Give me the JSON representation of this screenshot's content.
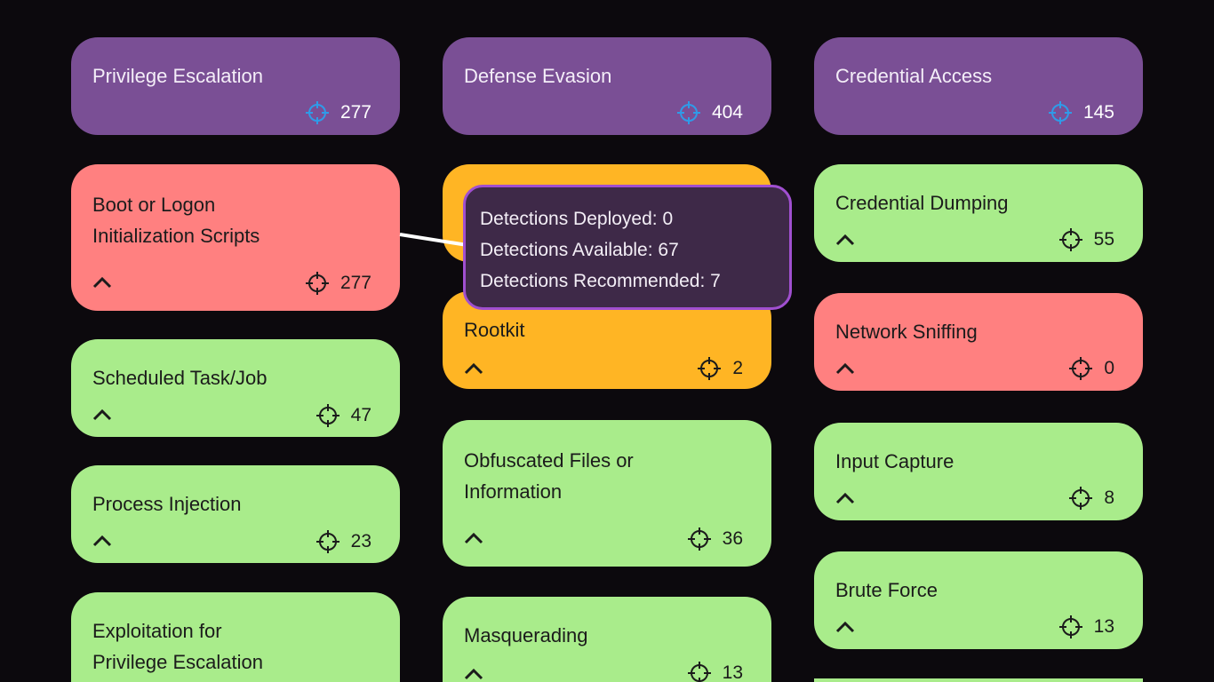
{
  "columns": [
    {
      "header": {
        "title": "Privilege Escalation",
        "count": "277"
      },
      "cards": [
        {
          "title": "Boot or Logon\nInitialization Scripts",
          "count": "277",
          "status": "red"
        },
        {
          "title": "Scheduled Task/Job",
          "count": "47",
          "status": "green"
        },
        {
          "title": "Process Injection",
          "count": "23",
          "status": "green"
        },
        {
          "title": "Exploitation for\nPrivilege Escalation",
          "count": "",
          "status": "green"
        }
      ]
    },
    {
      "header": {
        "title": "Defense Evasion",
        "count": "404"
      },
      "cards": [
        {
          "title": "",
          "count": "",
          "status": "orange"
        },
        {
          "title": "Rootkit",
          "count": "2",
          "status": "orange"
        },
        {
          "title": "Obfuscated Files or\nInformation",
          "count": "36",
          "status": "green"
        },
        {
          "title": "Masquerading",
          "count": "13",
          "status": "green"
        }
      ]
    },
    {
      "header": {
        "title": "Credential Access",
        "count": "145"
      },
      "cards": [
        {
          "title": "Credential Dumping",
          "count": "55",
          "status": "green"
        },
        {
          "title": "Network Sniffing",
          "count": "0",
          "status": "red"
        },
        {
          "title": "Input Capture",
          "count": "8",
          "status": "green"
        },
        {
          "title": "Brute Force",
          "count": "13",
          "status": "green"
        }
      ]
    }
  ],
  "tooltip": {
    "deployed": "Detections Deployed: 0",
    "available": "Detections Available: 67",
    "recommended": "Detections Recommended: 7"
  },
  "colors": {
    "purple": "#7a4f95",
    "red": "#ff8080",
    "green": "#a9ec8b",
    "orange": "#ffb524",
    "tooltip_bg": "#3e2948",
    "tooltip_border": "#a04fd0",
    "crosshair_header": "#2f9be8"
  },
  "icons": {
    "count": "crosshair-icon",
    "expand": "chevron-up-icon"
  }
}
